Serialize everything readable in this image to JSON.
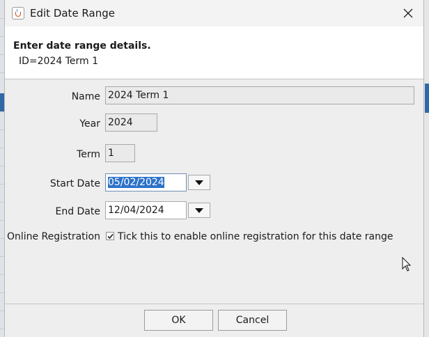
{
  "window": {
    "title": "Edit Date Range",
    "app_icon": "java-cup-icon",
    "close_icon": "close-icon"
  },
  "header": {
    "title": "Enter date range details.",
    "subtitle": "ID=2024 Term 1"
  },
  "form": {
    "name_label": "Name",
    "name_value": "2024 Term 1",
    "year_label": "Year",
    "year_value": "2024",
    "term_label": "Term",
    "term_value": "1",
    "start_label": "Start Date",
    "start_value": "05/02/2024",
    "end_label": "End Date",
    "end_value": "12/04/2024",
    "online_label": "Online Registration",
    "online_checked": true,
    "online_text": "Tick this to enable online registration for this date range"
  },
  "buttons": {
    "ok": "OK",
    "cancel": "Cancel"
  },
  "colors": {
    "selection": "#2e73c9",
    "background_selection": "#2f6aa6"
  }
}
